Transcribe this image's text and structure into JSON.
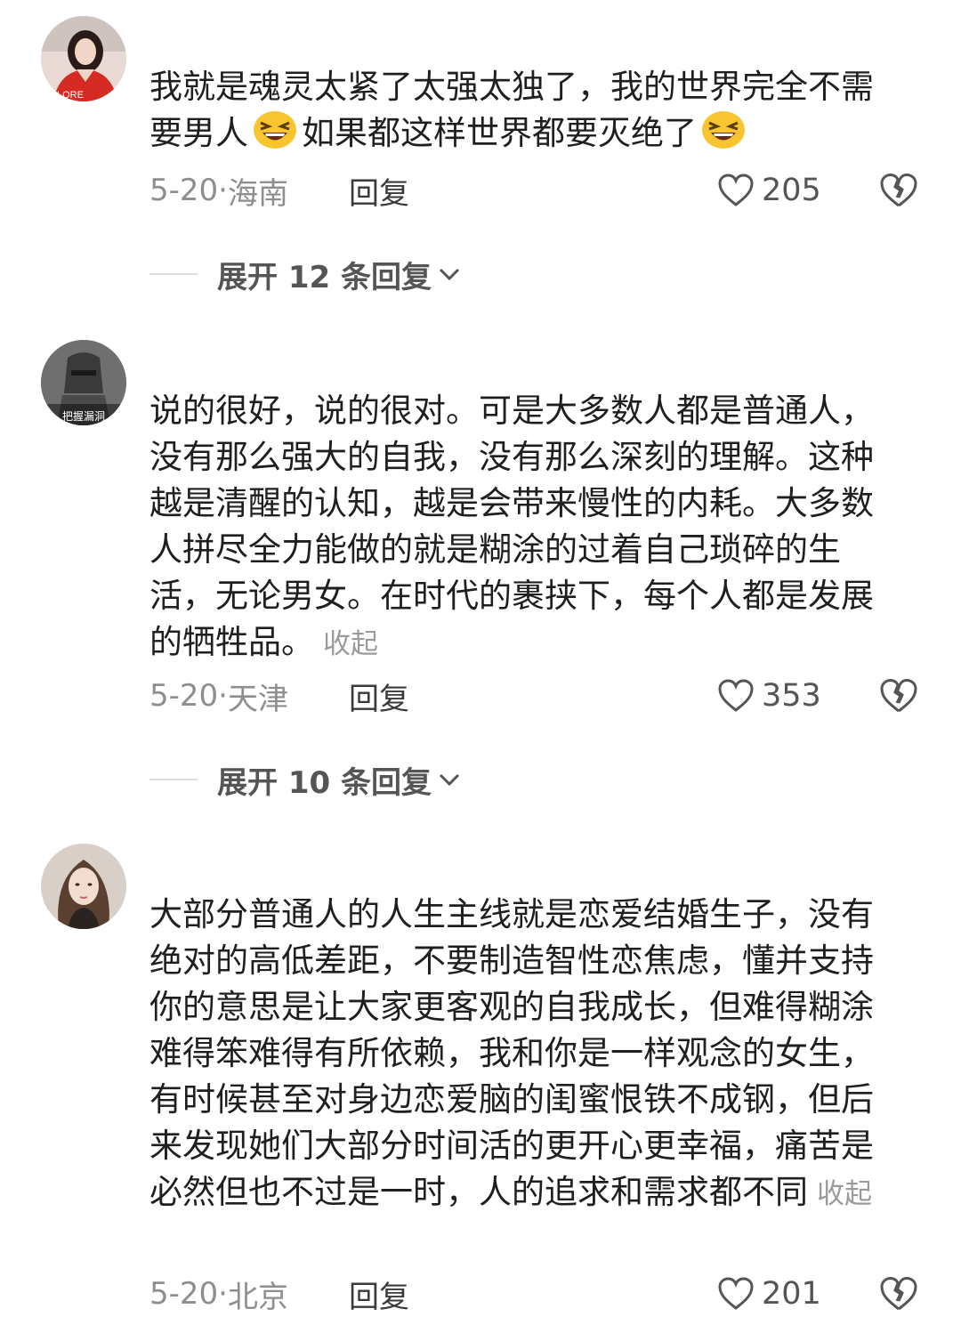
{
  "comments": [
    {
      "content_before_emoji": "我就是魂灵太紧了太强太独了，我的世界完全不需要男人",
      "content_middle": "如果都这样世界都要灭绝了",
      "emoji": "laughing-face-emoji",
      "date": "5-20·",
      "location": "海南",
      "reply_label": "回复",
      "likes": "205",
      "expand_label": "展开 12 条回复"
    },
    {
      "content": "说的很好，说的很对。可是大多数人都是普通人，没有那么强大的自我，没有那么深刻的理解。这种越是清醒的认知，越是会带来慢性的内耗。大多数人拼尽全力能做的就是糊涂的过着自己琐碎的生活，无论男女。在时代的裹挟下，每个人都是发展的牺牲品。",
      "collapse_label": "收起",
      "avatar_text": "把握漏洞",
      "date": "5-20·",
      "location": "天津",
      "reply_label": "回复",
      "likes": "353",
      "expand_label": "展开 10 条回复"
    },
    {
      "content": "大部分普通人的人生主线就是恋爱结婚生子，没有绝对的高低差距，不要制造智性恋焦虑，懂并支持你的意思是让大家更客观的自我成长，但难得糊涂难得笨难得有所依赖，我和你是一样观念的女生，有时候甚至对身边恋爱脑的闺蜜恨铁不成钢，但后来发现她们大部分时间活的更开心更幸福，痛苦是必然但也不过是一时，人的追求和需求都不同",
      "collapse_label": "收起",
      "date": "5-20·",
      "location": "北京",
      "reply_label": "回复",
      "likes": "201"
    }
  ],
  "avatar1_text": "LORE",
  "colors": {
    "meta": "#8e8e8e",
    "text": "#1f1f1f",
    "collapse": "#9a9a9a"
  }
}
